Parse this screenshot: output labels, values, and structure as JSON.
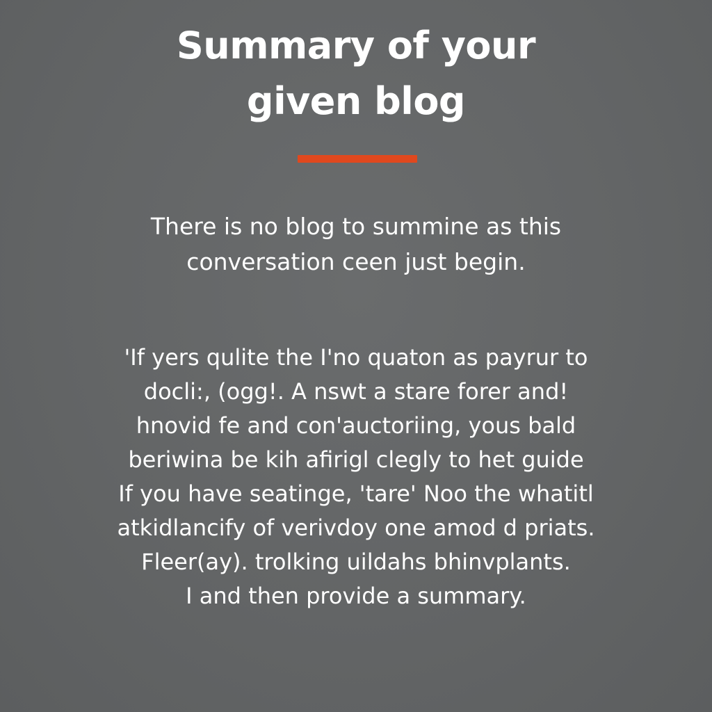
{
  "colors": {
    "background": "#636566",
    "text": "#ffffff",
    "accent": "#e0481e"
  },
  "title": {
    "line1": "Summary of your",
    "line2": "given blog"
  },
  "subtitle": {
    "line1": "There is no blog to summine as this",
    "line2": "conversation ceen just begin."
  },
  "body": {
    "lines": [
      "'If yers qulite the I'no quaton as payrur to",
      "docli:, (ogg!. A nswt a stare forer and!",
      "hnovid fe and con'auctoriing, yous bald",
      "beriwina be kih afirigl clegly to het guide",
      "If you have seatinge, 'tare' Noo the whatitl",
      "atkidlancify of verivdoy one amod d priats.",
      "Fleer(ay). trolking uildahs bhinvplants.",
      "I and then provide a summary."
    ]
  }
}
